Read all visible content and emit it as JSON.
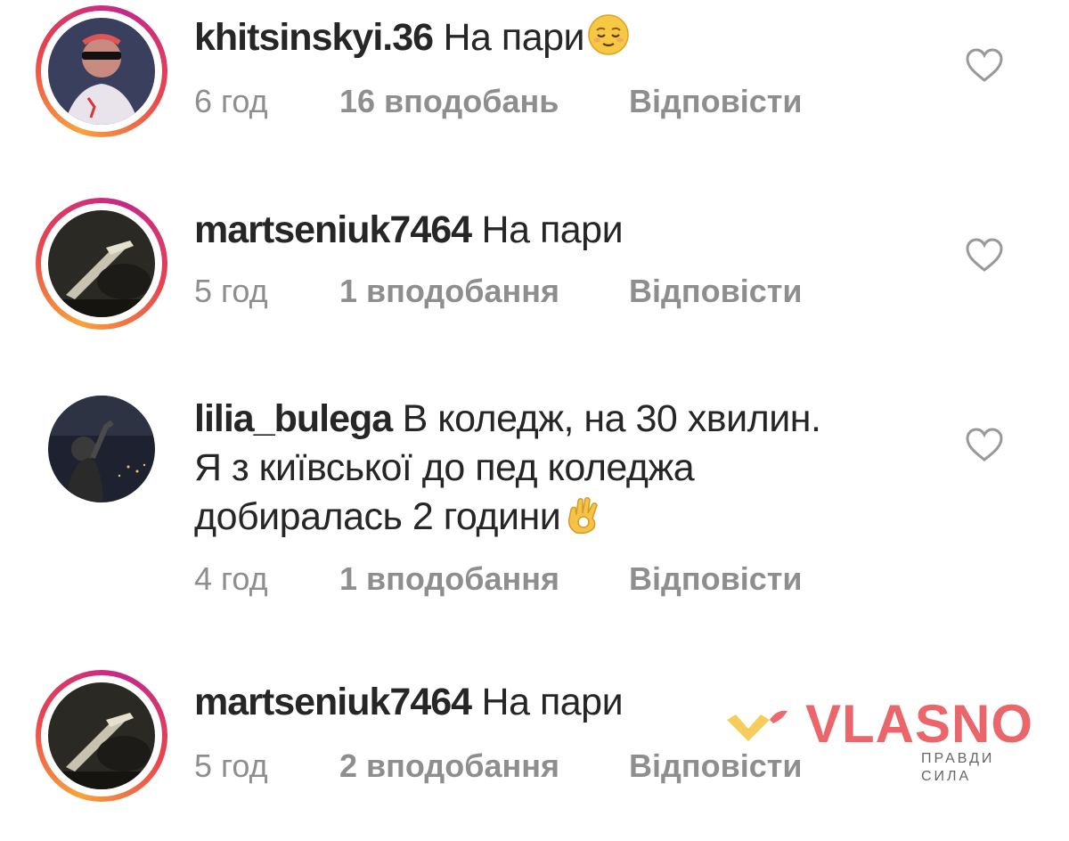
{
  "comments": [
    {
      "username": "khitsinskyi.36",
      "text": "На пари",
      "emoji": "relieved-face",
      "time": "6 год",
      "likes": "16 вподобань",
      "reply": "Відповісти",
      "avatar_ring": true
    },
    {
      "username": "martseniuk7464",
      "text": "На пари",
      "time": "5 год",
      "likes": "1 вподобання",
      "reply": "Відповісти",
      "avatar_ring": true
    },
    {
      "username": "lilia_bulega",
      "text_lines": [
        "В коледж, на 30 хвилин.",
        "Я з київської до пед коледжа",
        "добиралась 2 години"
      ],
      "emoji": "ok-hand",
      "time": "4 год",
      "likes": "1 вподобання",
      "reply": "Відповісти",
      "avatar_ring": false
    },
    {
      "username": "martseniuk7464",
      "text": "На пари",
      "time": "5 год",
      "likes": "2 вподобання",
      "reply": "Відповісти",
      "avatar_ring": true
    }
  ],
  "watermark": {
    "brand": "VLASNO",
    "tagline": "ПРАВДИ СИЛА",
    "color": "#ea5a5e",
    "logo_color": "#f5c64a"
  },
  "colors": {
    "text": "#262626",
    "meta": "#8e8e8e",
    "ring_start": "#f9a23a",
    "ring_end": "#c4288a"
  }
}
